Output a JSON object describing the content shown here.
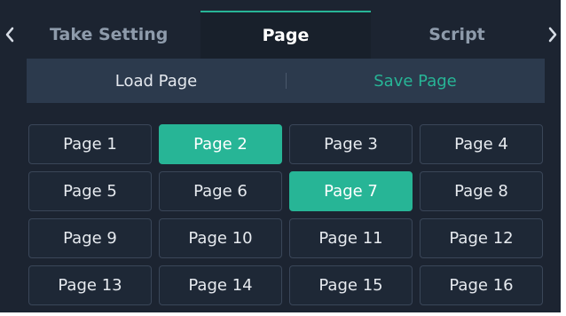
{
  "tabs": [
    {
      "label": "Take Setting",
      "active": false
    },
    {
      "label": "Page",
      "active": true
    },
    {
      "label": "Script",
      "active": false
    }
  ],
  "actions": {
    "load_label": "Load Page",
    "save_label": "Save Page"
  },
  "pages": [
    {
      "label": "Page 1",
      "active": false
    },
    {
      "label": "Page 2",
      "active": true
    },
    {
      "label": "Page 3",
      "active": false
    },
    {
      "label": "Page 4",
      "active": false
    },
    {
      "label": "Page 5",
      "active": false
    },
    {
      "label": "Page 6",
      "active": false
    },
    {
      "label": "Page 7",
      "active": true
    },
    {
      "label": "Page 8",
      "active": false
    },
    {
      "label": "Page 9",
      "active": false
    },
    {
      "label": "Page 10",
      "active": false
    },
    {
      "label": "Page 11",
      "active": false
    },
    {
      "label": "Page 12",
      "active": false
    },
    {
      "label": "Page 13",
      "active": false
    },
    {
      "label": "Page 14",
      "active": false
    },
    {
      "label": "Page 15",
      "active": false
    },
    {
      "label": "Page 16",
      "active": false
    }
  ],
  "icons": {
    "left": "chevron-left-icon",
    "right": "chevron-right-icon"
  },
  "colors": {
    "background": "#1c2431",
    "accent": "#27b596",
    "button": "#1e2836",
    "action_bar": "#2c3a4d"
  }
}
